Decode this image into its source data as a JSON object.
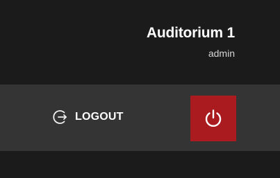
{
  "header": {
    "title": "Auditorium 1",
    "subtitle": "admin"
  },
  "actions": {
    "logout_label": "LOGOUT",
    "logout_icon": "logout-icon",
    "power_icon": "power-icon"
  },
  "colors": {
    "header_bg": "#1b1b1b",
    "actions_bg": "#343434",
    "power_bg": "#a91b1f",
    "text": "#ffffff"
  }
}
